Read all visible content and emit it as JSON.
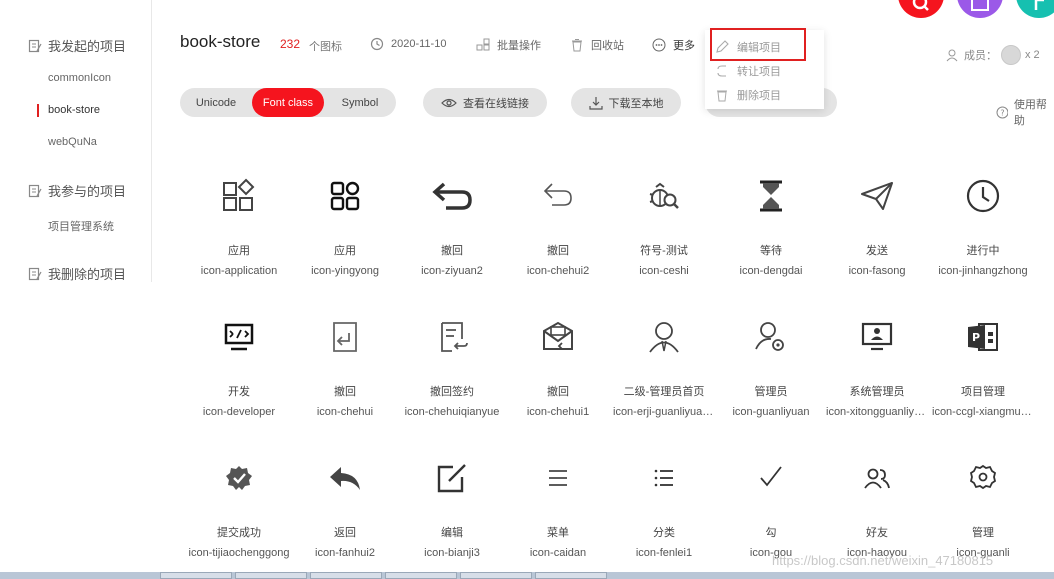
{
  "sidebar": {
    "groups": [
      {
        "label": "我发起的项目",
        "items": [
          "commonIcon",
          "book-store",
          "webQuNa"
        ],
        "active_index": 1
      },
      {
        "label": "我参与的项目",
        "items": [
          "项目管理系统"
        ]
      },
      {
        "label": "我删除的项目",
        "items": []
      }
    ]
  },
  "header": {
    "title": "book-store",
    "count": "232",
    "count_unit": "个图标",
    "date": "2020-11-10",
    "batch": "批量操作",
    "recycle": "回收站",
    "more": "更多",
    "members_label": "成员：",
    "members_count": "x 2"
  },
  "dropdown": {
    "items": [
      "编辑项目",
      "转让项目",
      "删除项目"
    ]
  },
  "toolbar": {
    "segments": [
      "Unicode",
      "Font class",
      "Symbol"
    ],
    "active_segment": "Font class",
    "view_link": "查看在线链接",
    "download": "下载至本地",
    "help": "使用帮助"
  },
  "icons": [
    {
      "name": "应用",
      "code": "icon-application",
      "icon": "application-icon"
    },
    {
      "name": "应用",
      "code": "icon-yingyong",
      "icon": "yingyong-icon"
    },
    {
      "name": "撤回",
      "code": "icon-ziyuan2",
      "icon": "undo-bold-icon"
    },
    {
      "name": "撤回",
      "code": "icon-chehui2",
      "icon": "undo-thin-icon"
    },
    {
      "name": "符号-测试",
      "code": "icon-ceshi",
      "icon": "bug-test-icon"
    },
    {
      "name": "等待",
      "code": "icon-dengdai",
      "icon": "hourglass-icon"
    },
    {
      "name": "发送",
      "code": "icon-fasong",
      "icon": "send-icon"
    },
    {
      "name": "进行中",
      "code": "icon-jinhangzhong",
      "icon": "clock-icon"
    },
    {
      "name": "开发",
      "code": "icon-developer",
      "icon": "developer-icon"
    },
    {
      "name": "撤回",
      "code": "icon-chehui",
      "icon": "doc-return-icon"
    },
    {
      "name": "撤回签约",
      "code": "icon-chehuiqianyue",
      "icon": "contract-return-icon"
    },
    {
      "name": "撤回",
      "code": "icon-chehui1",
      "icon": "mail-return-icon"
    },
    {
      "name": "二级-管理员首页",
      "code": "icon-erji-guanliyuanshouye",
      "icon": "admin-user-icon"
    },
    {
      "name": "管理员",
      "code": "icon-guanliyuan",
      "icon": "user-gear-icon"
    },
    {
      "name": "系统管理员",
      "code": "icon-xitongguanliyuan",
      "icon": "system-admin-icon"
    },
    {
      "name": "项目管理",
      "code": "icon-ccgl-xiangmuguanli",
      "icon": "project-manage-icon"
    },
    {
      "name": "提交成功",
      "code": "icon-tijiaochenggong",
      "icon": "success-badge-icon"
    },
    {
      "name": "返回",
      "code": "icon-fanhui2",
      "icon": "reply-icon"
    },
    {
      "name": "编辑",
      "code": "icon-bianji3",
      "icon": "edit-icon"
    },
    {
      "name": "菜单",
      "code": "icon-caidan",
      "icon": "menu-icon"
    },
    {
      "name": "分类",
      "code": "icon-fenlei1",
      "icon": "list-icon"
    },
    {
      "name": "勾",
      "code": "icon-gou",
      "icon": "check-icon"
    },
    {
      "name": "好友",
      "code": "icon-haoyou",
      "icon": "friends-icon"
    },
    {
      "name": "管理",
      "code": "icon-guanli",
      "icon": "gear-icon"
    }
  ],
  "watermark": "https://blog.csdn.net/weixin_47180815",
  "colors": {
    "accent": "#f5141e",
    "red_circle": "#f5141e",
    "purple_circle": "#9b59e8",
    "teal_circle": "#16c0b0"
  }
}
